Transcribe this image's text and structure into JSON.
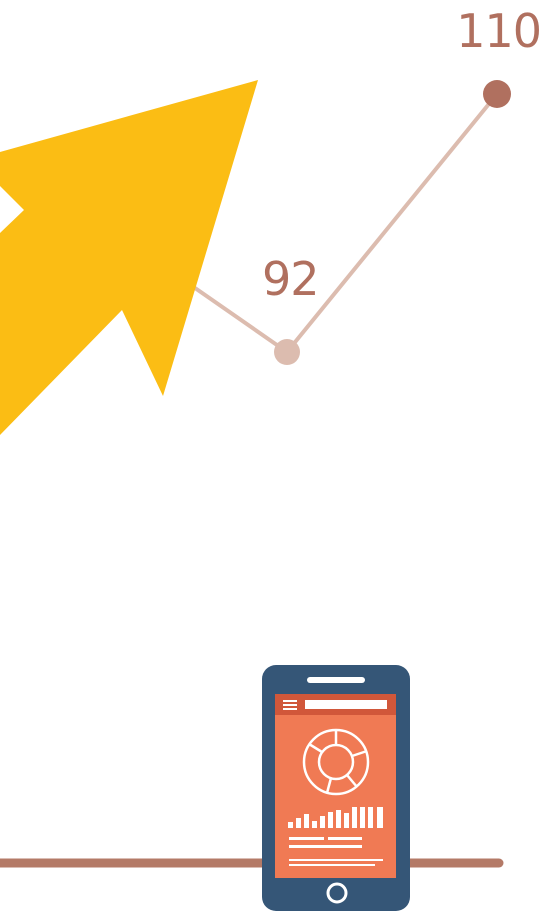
{
  "chart_data": {
    "type": "line",
    "x": [
      1,
      2,
      3
    ],
    "values": [
      null,
      92,
      110
    ],
    "data_labels": [
      "",
      "92",
      "110"
    ],
    "title": "",
    "xlabel": "",
    "ylabel": "",
    "grid": false
  },
  "labels": {
    "value_high": "110",
    "value_mid": "92"
  },
  "colors": {
    "label_text": "#b0705f",
    "line": "#dcbcaf",
    "point_high": "#b0705f",
    "point_mid": "#dcbcaf",
    "arrow": "#fbbd14",
    "ground_line": "#b47a67",
    "phone_body": "#355677",
    "phone_screen": "#f07a54",
    "phone_header": "#d1573a",
    "phone_detail": "#ffffff"
  },
  "icons": {
    "arrow": "trend-arrow-icon",
    "phone": "smartphone-icon",
    "menu": "hamburger-menu-icon",
    "donut": "donut-chart-icon",
    "bars": "bar-chart-icon",
    "home": "home-button-icon"
  }
}
